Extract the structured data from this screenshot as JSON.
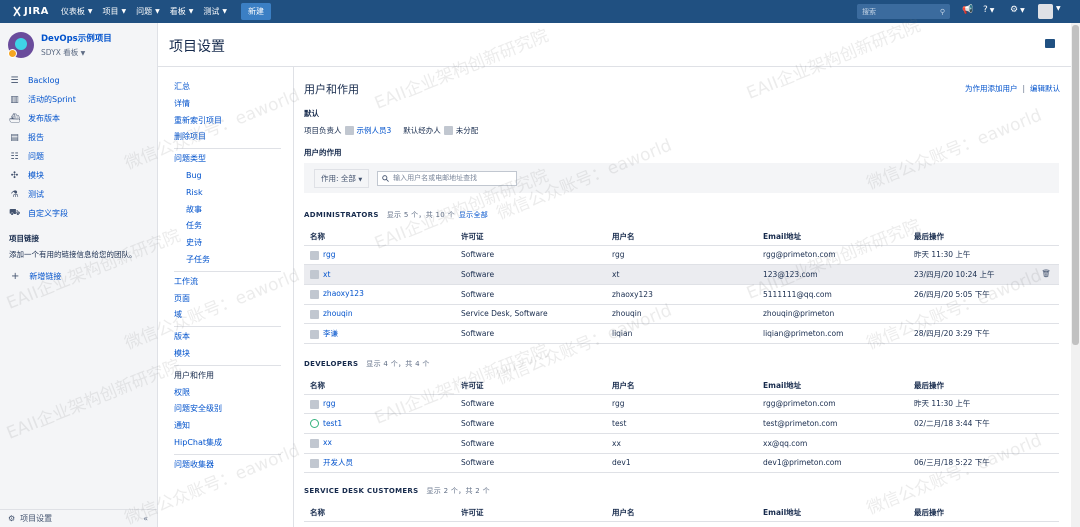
{
  "topbar": {
    "logo": "JIRA",
    "nav": [
      "仪表板",
      "项目",
      "问题",
      "看板",
      "测试"
    ],
    "create": "新建",
    "search_placeholder": "搜索"
  },
  "project": {
    "name": "DevOps示例项目",
    "board": "SDYX 看板"
  },
  "sidebar": {
    "items": [
      {
        "label": "Backlog",
        "icon": "backlog-icon"
      },
      {
        "label": "活动的Sprint",
        "icon": "sprint-icon"
      },
      {
        "label": "发布版本",
        "icon": "ship-icon"
      },
      {
        "label": "报告",
        "icon": "chart-icon"
      },
      {
        "label": "问题",
        "icon": "issues-icon"
      },
      {
        "label": "模块",
        "icon": "puzzle-icon"
      },
      {
        "label": "测试",
        "icon": "flask-icon"
      },
      {
        "label": "自定义字段",
        "icon": "tag-icon"
      }
    ],
    "links_title": "项目链接",
    "links_desc": "添加一个有用的链接信息给您的团队。",
    "add_link": "新增链接",
    "settings": "项目设置"
  },
  "page": {
    "title": "项目设置"
  },
  "admin_nav": {
    "group1": [
      "汇总",
      "详情",
      "重新索引项目",
      "删除项目"
    ],
    "issue_types": "问题类型",
    "issue_type_children": [
      "Bug",
      "Risk",
      "故事",
      "任务",
      "史诗",
      "子任务"
    ],
    "group3": [
      "工作流",
      "页面",
      "域"
    ],
    "group4": [
      "版本",
      "模块"
    ],
    "group5": [
      "用户和作用",
      "权限",
      "问题安全级别",
      "通知",
      "HipChat集成"
    ],
    "group6": [
      "问题收集器"
    ]
  },
  "main": {
    "title": "用户和作用",
    "add_user_link": "为作用添加用户",
    "edit_default_link": "编辑默认",
    "default_label": "默认",
    "lead_label": "项目负责人",
    "lead_value": "示例人员3",
    "assignee_label": "默认经办人",
    "assignee_value": "未分配",
    "role_label": "用户的作用",
    "role_select": "作用: 全部",
    "search_placeholder": "输入用户名或电邮地址查找",
    "columns": [
      "名称",
      "许可证",
      "用户名",
      "Email地址",
      "最后操作"
    ]
  },
  "groups": {
    "admins": {
      "title": "ADMINISTRATORS",
      "count": "显示 5 个，共 10 个",
      "show_all": "显示全部",
      "rows": [
        {
          "name": "rgg",
          "license": "Software",
          "username": "rgg",
          "email": "rgg@primeton.com",
          "last": "昨天 11:30 上午"
        },
        {
          "name": "xt",
          "license": "Software",
          "username": "xt",
          "email": "123@123.com",
          "last": "23/四月/20 10:24 上午"
        },
        {
          "name": "zhaoxy123",
          "license": "Software",
          "username": "zhaoxy123",
          "email": "5111111@qq.com",
          "last": "26/四月/20 5:05 下午"
        },
        {
          "name": "zhouqin",
          "license": "Service Desk, Software",
          "username": "zhouqin",
          "email": "zhouqin@primeton",
          "last": ""
        },
        {
          "name": "李谦",
          "license": "Software",
          "username": "liqian",
          "email": "liqian@primeton.com",
          "last": "28/四月/20 3:29 下午"
        }
      ]
    },
    "developers": {
      "title": "DEVELOPERS",
      "count": "显示 4 个，共 4 个",
      "rows": [
        {
          "name": "rgg",
          "license": "Software",
          "username": "rgg",
          "email": "rgg@primeton.com",
          "last": "昨天 11:30 上午"
        },
        {
          "name": "test1",
          "license": "Software",
          "username": "test",
          "email": "test@primeton.com",
          "last": "02/二月/18 3:44 下午"
        },
        {
          "name": "xx",
          "license": "Software",
          "username": "xx",
          "email": "xx@qq.com",
          "last": ""
        },
        {
          "name": "开发人员",
          "license": "Software",
          "username": "dev1",
          "email": "dev1@primeton.com",
          "last": "06/三月/18 5:22 下午"
        }
      ]
    },
    "sd_customers": {
      "title": "SERVICE DESK CUSTOMERS",
      "count": "显示 2 个，共 2 个"
    }
  },
  "watermarks": [
    "EAII企业架构创新研究院",
    "微信公众账号：eaworld"
  ],
  "colors": {
    "topbar": "#205081",
    "link": "#0052cc",
    "create": "#3b7fc4"
  }
}
